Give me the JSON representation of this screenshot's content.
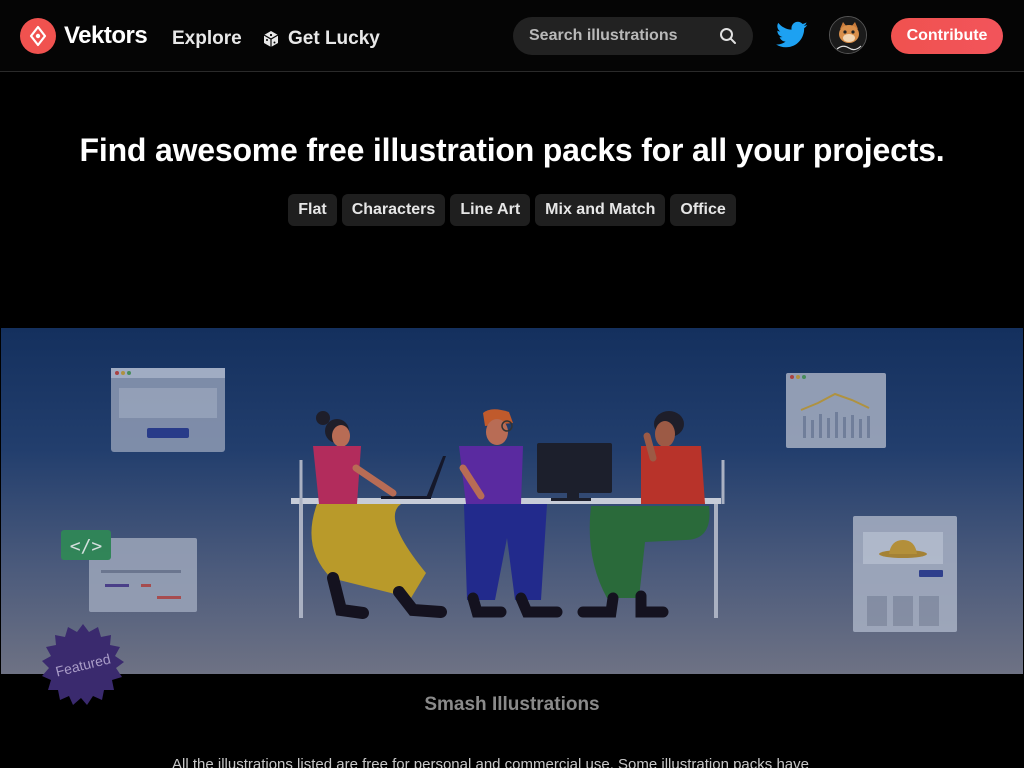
{
  "header": {
    "brand": "Vektors",
    "nav": {
      "explore": "Explore",
      "lucky": "Get Lucky"
    },
    "search": {
      "placeholder": "Search illustrations",
      "value": ""
    },
    "contribute_label": "Contribute",
    "icons": {
      "logo": "pen-nib-icon",
      "lucky": "dice-icon",
      "search": "search-icon",
      "social": "twitter-icon",
      "user": "avatar"
    },
    "colors": {
      "accent": "#f0524f",
      "twitter": "#1da1f2"
    }
  },
  "hero": {
    "title": "Find awesome free illustration packs for all your projects.",
    "tags": [
      "Flat",
      "Characters",
      "Line Art",
      "Mix and Match",
      "Office"
    ]
  },
  "featured": {
    "badge": "Featured",
    "pack_title": "Smash Illustrations",
    "note": "All the illustrations listed are free for personal and commercial use. Some illustration packs have"
  }
}
